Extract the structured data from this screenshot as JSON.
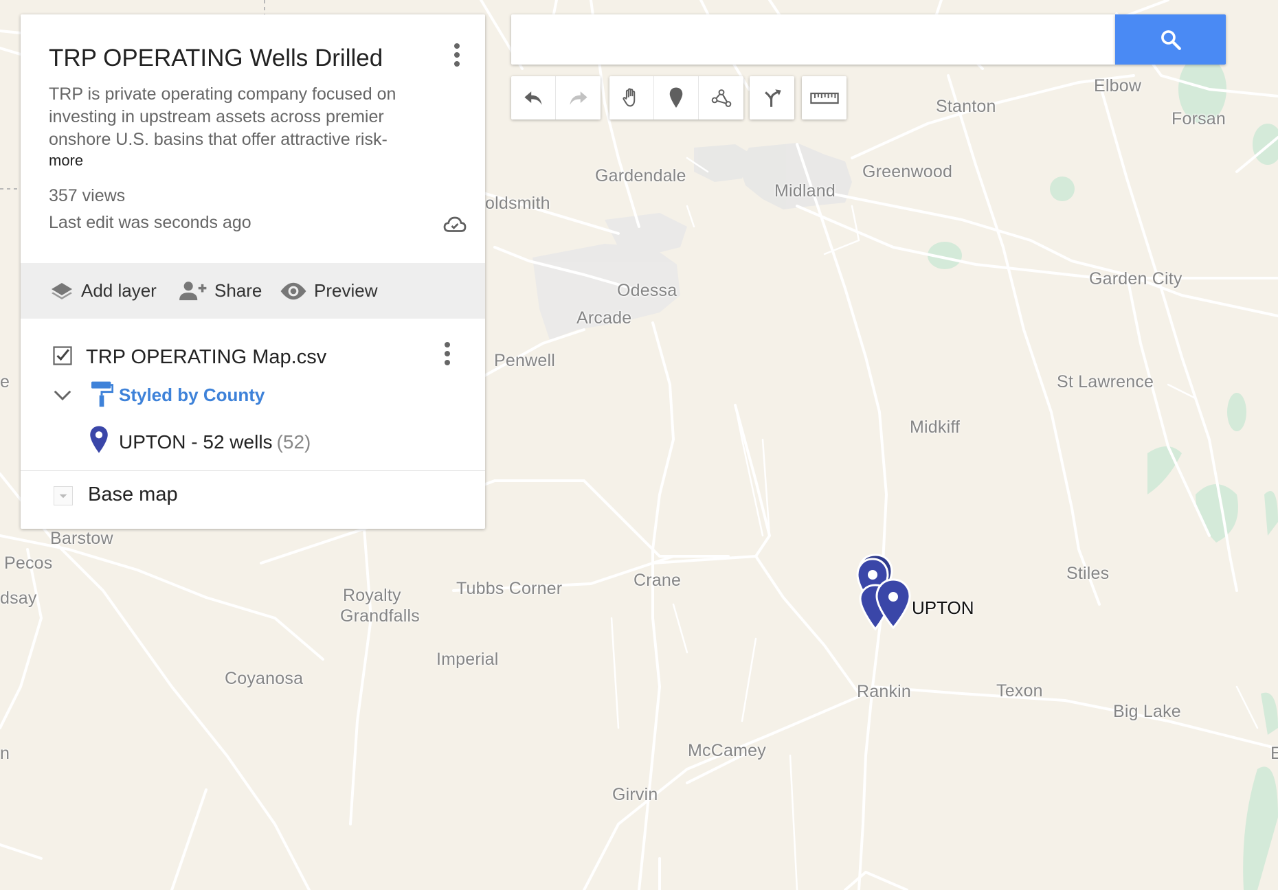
{
  "panel": {
    "title": "TRP OPERATING Wells Drilled",
    "description": "TRP is private operating company focused on investing in upstream assets across premier onshore U.S. basins that offer attractive risk-",
    "more_link": "more",
    "views": "357 views",
    "last_edit": "Last edit was seconds ago",
    "actions": {
      "add_layer": "Add layer",
      "share": "Share",
      "preview": "Preview"
    },
    "layer": {
      "name": "TRP OPERATING Map.csv",
      "checked": true,
      "style_label": "Styled by County",
      "group_label": "UPTON - 52 wells",
      "group_count": "(52)",
      "group_color": "#3a46a8"
    },
    "base_map_label": "Base map"
  },
  "search": {
    "value": "",
    "placeholder": ""
  },
  "toolbar": {
    "tools": [
      "undo-icon",
      "redo-icon",
      "hand-icon",
      "add-marker-icon",
      "draw-line-icon",
      "directions-icon",
      "ruler-icon"
    ]
  },
  "map": {
    "places": {
      "elbow": "Elbow",
      "stanton": "Stanton",
      "forsan": "Forsan",
      "gardendale": "Gardendale",
      "greenwood": "Greenwood",
      "midland": "Midland",
      "goldsmith": "oldsmith",
      "garden_city": "Garden City",
      "odessa": "Odessa",
      "arcade": "Arcade",
      "penwell": "Penwell",
      "st_lawrence": "St Lawrence",
      "midkiff": "Midkiff",
      "barstow": "Barstow",
      "pecos": "Pecos",
      "lindsay": "dsay",
      "royalty": "Royalty",
      "grandfalls": "Grandfalls",
      "tubbs_corner": "Tubbs Corner",
      "crane": "Crane",
      "stiles": "Stiles",
      "imperial": "Imperial",
      "coyanosa": "Coyanosa",
      "rankin": "Rankin",
      "texon": "Texon",
      "big_lake": "Big Lake",
      "mccamey": "McCamey",
      "girvin": "Girvin",
      "edge_left_1": "e",
      "edge_left_2": "n",
      "edge_right": "E"
    },
    "marker_label": "UPTON",
    "marker_color": "#3a46a8"
  }
}
